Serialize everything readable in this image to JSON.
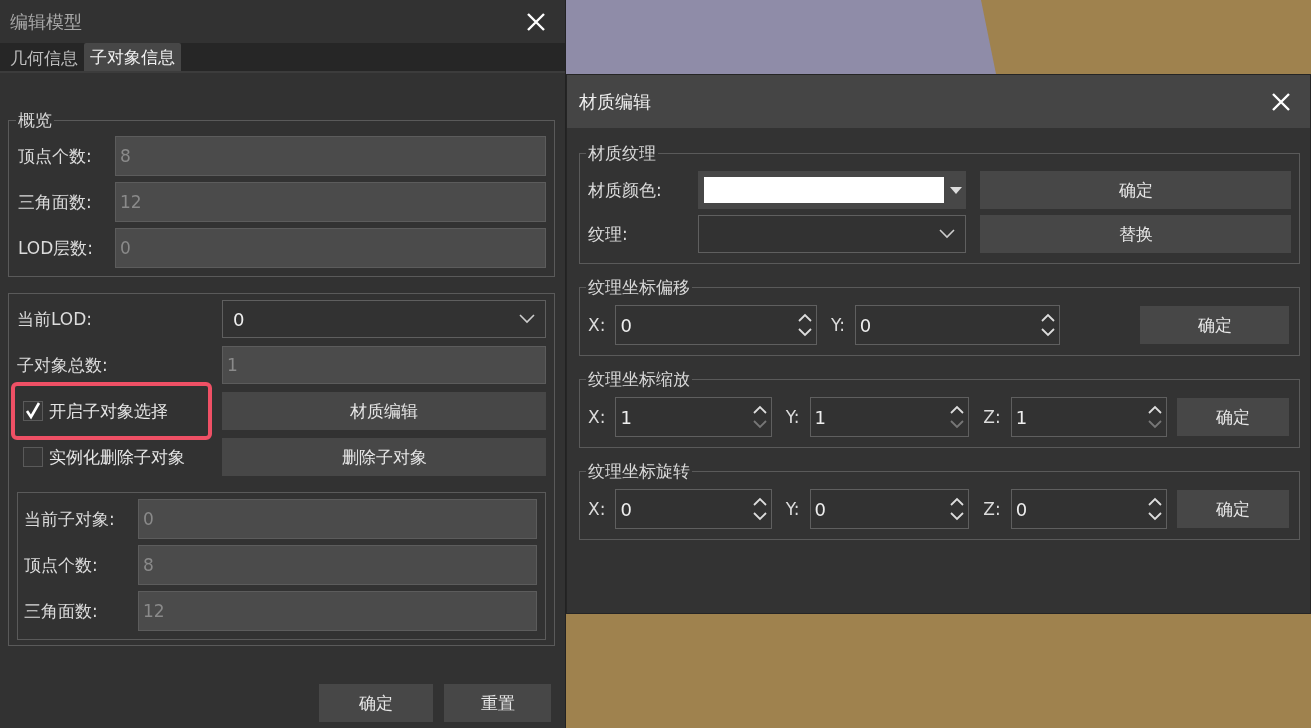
{
  "model_dialog": {
    "title": "编辑模型",
    "tabs": [
      {
        "label": "几何信息",
        "selected": false
      },
      {
        "label": "子对象信息",
        "selected": true
      }
    ],
    "overview": {
      "title": "概览",
      "fields": [
        {
          "label": "顶点个数:",
          "value": "8"
        },
        {
          "label": "三角面数:",
          "value": "12"
        },
        {
          "label": "LOD层数:",
          "value": "0"
        }
      ]
    },
    "lod": {
      "label": "当前LOD:",
      "value": "0"
    },
    "subobject_count": {
      "label": "子对象总数:",
      "value": "1"
    },
    "checkboxes": [
      {
        "label": "开启子对象选择",
        "checked": true,
        "highlighted": true
      },
      {
        "label": "实例化删除子对象",
        "checked": false,
        "highlighted": false
      }
    ],
    "side_buttons": [
      "材质编辑",
      "删除子对象"
    ],
    "current": [
      {
        "label": "当前子对象:",
        "value": "0"
      },
      {
        "label": "顶点个数:",
        "value": "8"
      },
      {
        "label": "三角面数:",
        "value": "12"
      }
    ],
    "buttons": [
      "确定",
      "重置"
    ]
  },
  "material_dialog": {
    "title": "材质编辑",
    "texture_group": {
      "title": "材质纹理",
      "color_label": "材质颜色:",
      "color": "#ffffff",
      "texture_label": "纹理:",
      "buttons": [
        "确定",
        "替换"
      ]
    },
    "groups": [
      {
        "title": "纹理坐标偏移",
        "axes": [
          {
            "label": "X:",
            "value": "0",
            "down_disabled": false
          },
          {
            "label": "Y:",
            "value": "0",
            "down_disabled": false
          }
        ],
        "button": "确定"
      },
      {
        "title": "纹理坐标缩放",
        "axes": [
          {
            "label": "X:",
            "value": "1",
            "down_disabled": true
          },
          {
            "label": "Y:",
            "value": "1",
            "down_disabled": true
          },
          {
            "label": "Z:",
            "value": "1",
            "down_disabled": true
          }
        ],
        "button": "确定"
      },
      {
        "title": "纹理坐标旋转",
        "axes": [
          {
            "label": "X:",
            "value": "0",
            "down_disabled": false
          },
          {
            "label": "Y:",
            "value": "0",
            "down_disabled": false
          },
          {
            "label": "Z:",
            "value": "0",
            "down_disabled": false
          }
        ],
        "button": "确定"
      }
    ]
  }
}
